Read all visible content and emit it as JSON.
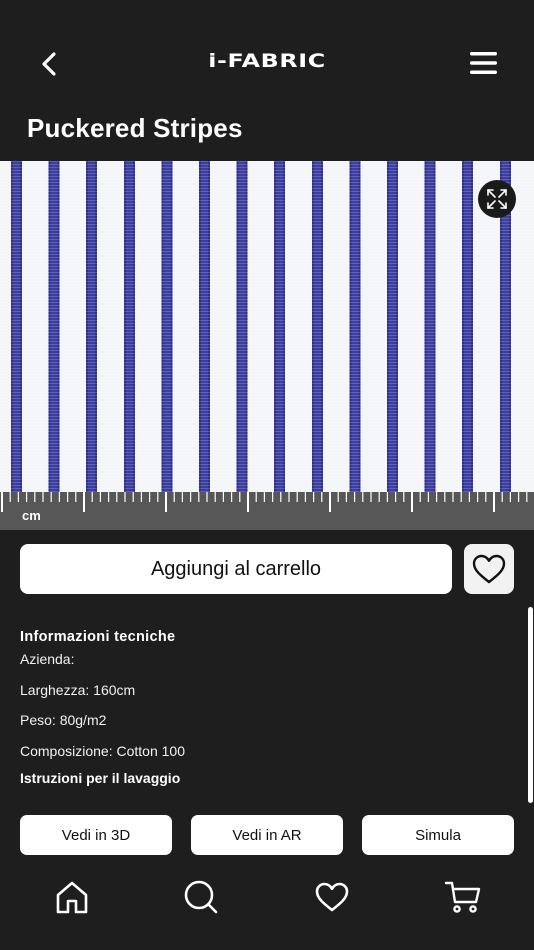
{
  "header": {
    "logo": "i-FABRIC",
    "back_icon": "chevron-left-icon",
    "menu_icon": "hamburger-menu-icon"
  },
  "page_title": "Puckered Stripes",
  "fabric": {
    "stripe_color": "#2f3192",
    "ground_color": "#f4f5f8",
    "expand_icon": "expand-arrows-icon"
  },
  "ruler": {
    "unit": "cm"
  },
  "actions": {
    "add_to_cart": "Aggiungi al carrello",
    "favorite_icon": "heart-outline-icon"
  },
  "info": {
    "title": "Informazioni tecniche",
    "company": "Azienda:",
    "width": "Larghezza: 160cm",
    "weight": "Peso: 80g/m2",
    "composition": "Composizione: Cotton 100",
    "wash": "Istruzioni per il lavaggio"
  },
  "buttons": {
    "view_3d": "Vedi in 3D",
    "view_ar": "Vedi in AR",
    "simulate": "Simula"
  },
  "tabbar": {
    "home_icon": "home-icon",
    "search_icon": "search-icon",
    "favorites_icon": "heart-icon",
    "cart_icon": "cart-icon"
  }
}
